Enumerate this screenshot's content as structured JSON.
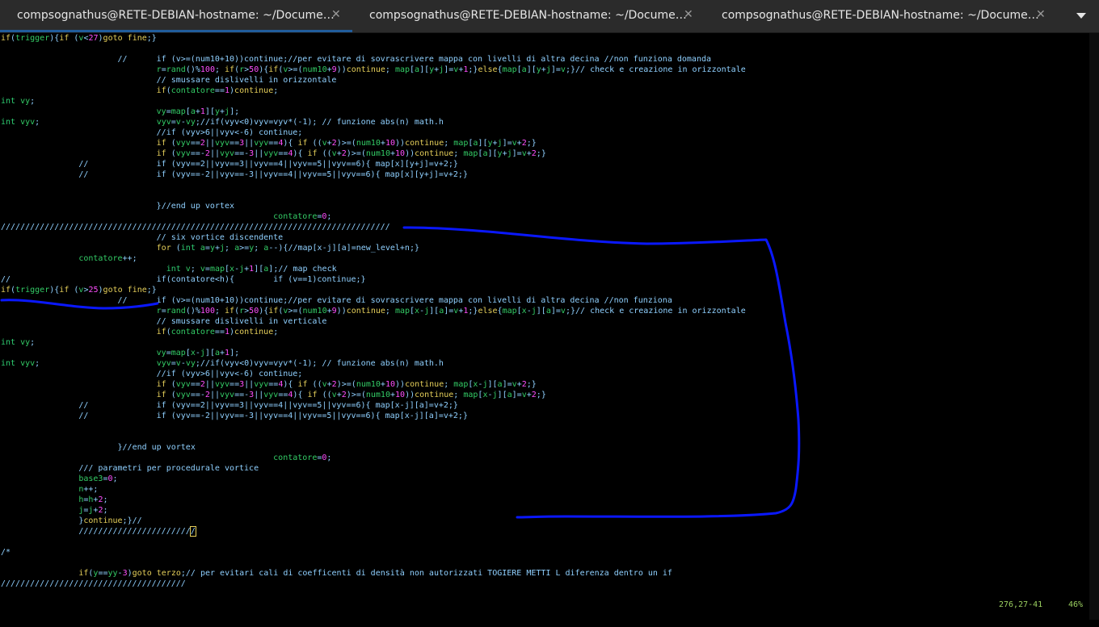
{
  "tabs": [
    {
      "label": "compsognathus@RETE-DEBIAN-hostname: ~/Docume…",
      "active": true
    },
    {
      "label": "compsognathus@RETE-DEBIAN-hostname: ~/Docume…",
      "active": false
    },
    {
      "label": "compsognathus@RETE-DEBIAN-hostname: ~/Docume…",
      "active": false
    }
  ],
  "close_glyph": "✕",
  "status": {
    "position": "276,27-41",
    "percent": "46%"
  },
  "colors": {
    "comment": "#8fd0ff",
    "type": "#2ecc71",
    "keyword": "#e5cf5a",
    "number": "#ff4fff",
    "annotation": "#0a18ff"
  },
  "code_lines": [
    "if(trigger){if (v<27)goto fine;}",
    "",
    "                        //      if (v>=(num10+10))continue;//per evitare di sovrascrivere mappa con livelli di altra decina //non funziona domanda",
    "                                r=rand()%100; if(r>50){if(v>=(num10+9))continue; map[a][y+j]=v+1;}else{map[a][y+j]=v;}// check e creazione in orizzontale",
    "                                // smussare dislivelli in orizzontale",
    "                                if(contatore==1)continue;",
    "int vy;",
    "                                vy=map[a+1][y+j];",
    "int vyv;                        vyv=v-vy;//if(vyv<0)vyv=vyv*(-1); // funzione abs(n) math.h",
    "                                //if (vyv>6||vyv<-6) continue;",
    "                                if (vyv==2||vyv==3||vyv==4){ if ((v+2)>=(num10+10))continue; map[a][y+j]=v+2;}",
    "                                if (vyv==-2||vyv==-3||vyv==4){ if ((v+2)>=(num10+10))continue; map[a][y+j]=v+2;}",
    "                //              if (vyv==2||vyv==3||vyv==4||vyv==5||vyv==6){ map[x][y+j]=v+2;}",
    "                //              if (vyv==-2||vyv==-3||vyv==4||vyv==5||vyv==6){ map[x][y+j]=v+2;}",
    "",
    "",
    "                                }//end up vortex",
    "                                                        contatore=0;",
    "////////////////////////////////////////////////////////////////////////////////",
    "                                // six vortice discendente",
    "                                for (int a=y+j; a>=y; a--){//map[x-j][a]=new_level+n;}",
    "                contatore++;",
    "                                  int v; v=map[x-j+1][a];// map check",
    "//                              if(contatore<h){        if (v==1)continue;}",
    "if(trigger){if (v>25)goto fine;}",
    "                        //      if (v>=(num10+10))continue;//per evitare di sovrascrivere mappa con livelli di altra decina //non funziona",
    "                                r=rand()%100; if(r>50){if(v>=(num10+9))continue; map[x-j][a]=v+1;}else{map[x-j][a]=v;}// check e creazione in orizzontale",
    "                                // smussare dislivelli in verticale",
    "                                if(contatore==1)continue;",
    "int vy;",
    "                                vy=map[x-j][a+1];",
    "int vyv;                        vyv=v-vy;//if(vyv<0)vyv=vyv*(-1); // funzione abs(n) math.h",
    "                                //if (vyv>6||vyv<-6) continue;",
    "                                if (vyv==2||vyv==3||vyv==4){ if ((v+2)>=(num10+10))continue; map[x-j][a]=v+2;}",
    "                                if (vyv==-2||vyv==-3||vyv==4){ if ((v+2)>=(num10+10))continue; map[x-j][a]=v+2;}",
    "                //              if (vyv==2||vyv==3||vyv==4||vyv==5||vyv==6){ map[x-j][a]=v+2;}",
    "                //              if (vyv==-2||vyv==-3||vyv==4||vyv==5||vyv==6){ map[x-j][a]=v+2;}",
    "",
    "",
    "                        }//end up vortex",
    "                                                        contatore=0;",
    "                /// parametri per procedurale vortice",
    "                base3=0;",
    "                n++;",
    "                h=h+2;",
    "                j=j+2;",
    "                }continue;}//",
    "                ////////////////////////",
    "",
    "/*",
    "",
    "                if(y==yy-3)goto terzo;// per evitari cali di coefficenti di densità non autorizzati TOGIERE METTI L diferenza dentro un if",
    "//////////////////////////////////////"
  ]
}
